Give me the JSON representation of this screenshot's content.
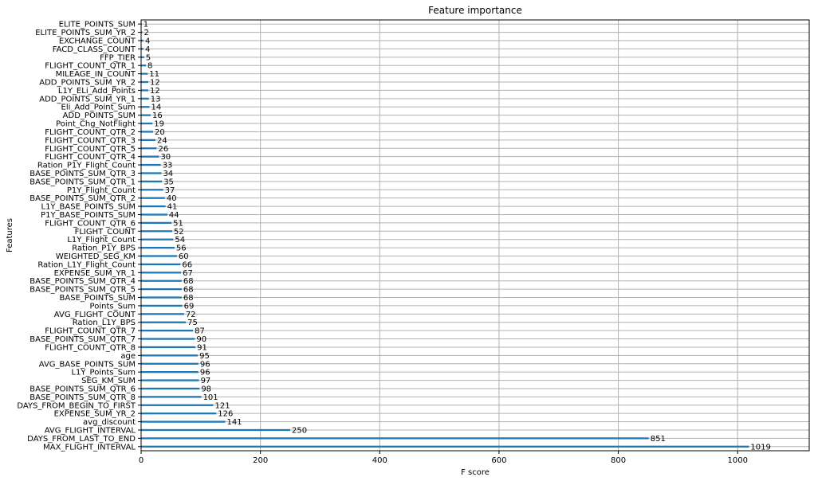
{
  "chart_data": {
    "type": "bar",
    "orientation": "horizontal",
    "title": "Feature importance",
    "xlabel": "F score",
    "ylabel": "Features",
    "xlim": [
      0,
      1120
    ],
    "xticks": [
      0,
      200,
      400,
      600,
      800,
      1000
    ],
    "grid": true,
    "bar_color": "#1f77b4",
    "categories": [
      "MAX_FLIGHT_INTERVAL",
      "DAYS_FROM_LAST_TO_END",
      "AVG_FLIGHT_INTERVAL",
      "avg_discount",
      "EXPENSE_SUM_YR_2",
      "DAYS_FROM_BEGIN_TO_FIRST",
      "BASE_POINTS_SUM_QTR_8",
      "BASE_POINTS_SUM_QTR_6",
      "SEG_KM_SUM",
      "L1Y_Points_Sum",
      "AVG_BASE_POINTS_SUM",
      "age",
      "FLIGHT_COUNT_QTR_8",
      "BASE_POINTS_SUM_QTR_7",
      "FLIGHT_COUNT_QTR_7",
      "Ration_L1Y_BPS",
      "AVG_FLIGHT_COUNT",
      "Points_Sum",
      "BASE_POINTS_SUM",
      "BASE_POINTS_SUM_QTR_5",
      "BASE_POINTS_SUM_QTR_4",
      "EXPENSE_SUM_YR_1",
      "Ration_L1Y_Flight_Count",
      "WEIGHTED_SEG_KM",
      "Ration_P1Y_BPS",
      "L1Y_Flight_Count",
      "FLIGHT_COUNT",
      "FLIGHT_COUNT_QTR_6",
      "P1Y_BASE_POINTS_SUM",
      "L1Y_BASE_POINTS_SUM",
      "BASE_POINTS_SUM_QTR_2",
      "P1Y_Flight_Count",
      "BASE_POINTS_SUM_QTR_1",
      "BASE_POINTS_SUM_QTR_3",
      "Ration_P1Y_Flight_Count",
      "FLIGHT_COUNT_QTR_4",
      "FLIGHT_COUNT_QTR_5",
      "FLIGHT_COUNT_QTR_3",
      "FLIGHT_COUNT_QTR_2",
      "Point_Chg_NotFlight",
      "ADD_POINTS_SUM",
      "Eli_Add_Point_Sum",
      "ADD_POINTS_SUM_YR_1",
      "L1Y_ELi_Add_Points",
      "ADD_POINTS_SUM_YR_2",
      "MILEAGE_IN_COUNT",
      "FLIGHT_COUNT_QTR_1",
      "FFP_TIER",
      "FACD_CLASS_COUNT",
      "EXCHANGE_COUNT",
      "ELITE_POINTS_SUM_YR_2",
      "ELITE_POINTS_SUM"
    ],
    "values": [
      1019,
      851,
      250,
      141,
      126,
      121,
      101,
      98,
      97,
      96,
      96,
      95,
      91,
      90,
      87,
      75,
      72,
      69,
      68,
      68,
      68,
      67,
      66,
      60,
      56,
      54,
      52,
      51,
      44,
      41,
      40,
      37,
      35,
      34,
      33,
      30,
      26,
      24,
      20,
      19,
      16,
      14,
      13,
      12,
      12,
      11,
      8,
      5,
      4,
      4,
      2,
      1
    ]
  }
}
